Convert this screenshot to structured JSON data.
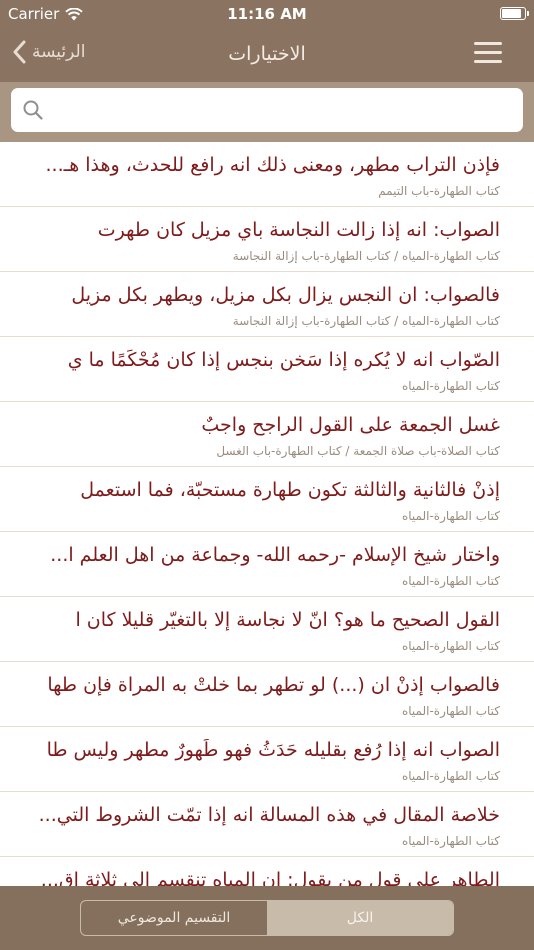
{
  "status_bar": {
    "carrier": "Carrier",
    "time": "11:16 AM"
  },
  "nav": {
    "back_label": "الرئيسة",
    "title": "الاختيارات"
  },
  "search": {
    "placeholder": ""
  },
  "items": [
    {
      "text": "فإذن التراب مطهر، ومعنى ذلك انه رافع للحدث، وهذا هـ...",
      "source": "كتاب الطهارة-باب التيمم"
    },
    {
      "text": "الصواب: انه إذا زالت النجاسة باي مزيل كان طهرت",
      "source": "كتاب الطهارة-المياه / كتاب الطهارة-باب إزالة النجاسة"
    },
    {
      "text": "فالصواب: ان النجس يزال بكل مزيل، ويطهر بكل مزيل",
      "source": "كتاب الطهارة-المياه / كتاب الطهارة-باب إزالة النجاسة"
    },
    {
      "text": "الصّواب انه لا يُكره إذا سَخن بنجسٍ إذا كان مُحْكَمًا ما ي",
      "source": "كتاب الطهارة-المياه"
    },
    {
      "text": "غسل الجمعة على القول الراجح واجبٌ",
      "source": "كتاب الصلاة-باب صلاة الجمعة / كتاب الطهارة-باب الغسل"
    },
    {
      "text": "إذنْ فالثانية والثالثة تكون طهارة مستحبّة، فما استعمل",
      "source": "كتاب الطهارة-المياه"
    },
    {
      "text": "واختار شيخ الإسلام -رحمه الله- وجماعة من اهل العلم ا...",
      "source": "كتاب الطهارة-المياه"
    },
    {
      "text": "القول الصحيح ما هو؟ انّ لا نجاسة إلا بالتغيّر قليلا كان ا",
      "source": "كتاب الطهارة-المياه"
    },
    {
      "text": "فالصواب إذنْ ان (...) لو تطهر بما خلتْ به المراة فإن طها",
      "source": "كتاب الطهارة-المياه"
    },
    {
      "text": "الصواب انه إذا رُفع بقليله حَدَثُ فهو طَهورٌ مطهر وليس طا",
      "source": "كتاب الطهارة-المياه"
    },
    {
      "text": "خلاصة المقال في هذه المسالة انه إذا تمّت الشروط التي...",
      "source": "كتاب الطهارة-المياه"
    },
    {
      "text": "الطاهر على قول من يقول: إن المياه تنقسم إلى ثلاثة اق...",
      "source": ""
    }
  ],
  "tabs": {
    "all": "الكل",
    "topical": "التقسيم الموضوعي"
  }
}
